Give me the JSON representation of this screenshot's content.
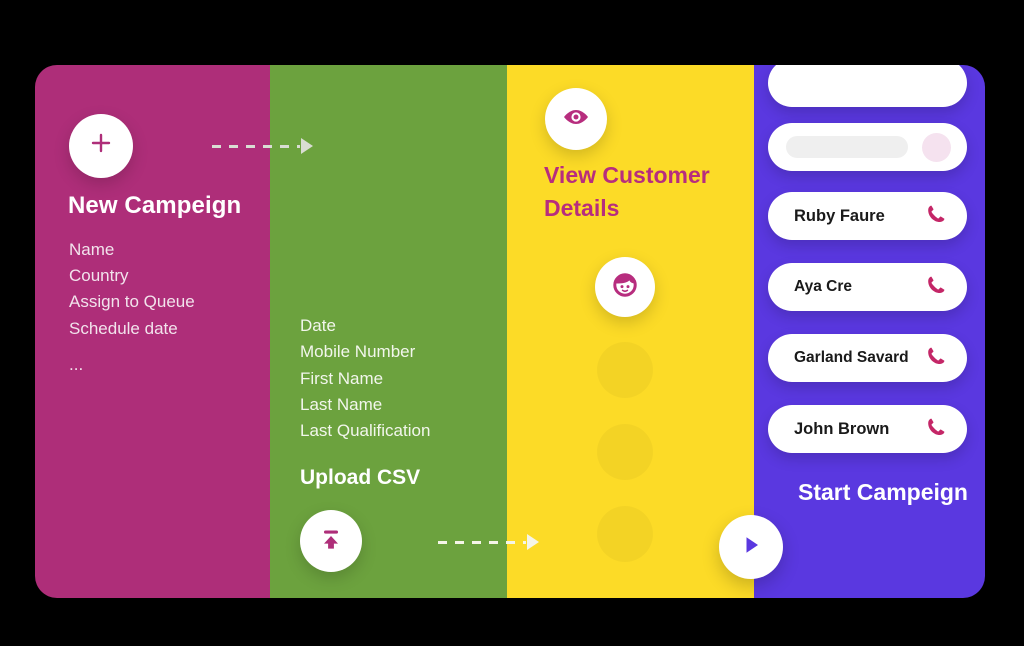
{
  "colors": {
    "magenta": "#AE2E79",
    "green": "#6CA23E",
    "yellow": "#FCDB27",
    "purple": "#5A38E0",
    "accent_pink": "#B72D7E",
    "phone_icon": "#C42667",
    "background": "#000000"
  },
  "campaign_panel": {
    "add_icon": "plus-icon",
    "title": "New Campeign",
    "fields": [
      "Name",
      "Country",
      "Assign to Queue",
      "Schedule date"
    ],
    "more": "..."
  },
  "csv_panel": {
    "fields": [
      "Date",
      "Mobile Number",
      "First Name",
      "Last Name",
      "Last Qualification"
    ],
    "title": "Upload CSV",
    "upload_icon": "upload-icon"
  },
  "customer_panel": {
    "eye_icon": "eye-icon",
    "title": "View Customer Details",
    "avatar_icon": "person-icon",
    "placeholder_dots": 3
  },
  "contacts_panel": {
    "cards": [
      {
        "type": "blank",
        "name": ""
      },
      {
        "type": "skeleton",
        "name": ""
      },
      {
        "type": "contact",
        "name": "Ruby Faure",
        "action_icon": "phone-icon"
      },
      {
        "type": "contact",
        "name": "Aya Cre",
        "action_icon": "phone-icon"
      },
      {
        "type": "contact",
        "name": "Garland Savard",
        "action_icon": "phone-icon"
      },
      {
        "type": "contact",
        "name": "John Brown",
        "action_icon": "phone-icon"
      }
    ],
    "start_title": "Start Campeign",
    "play_icon": "play-icon"
  },
  "connectors": [
    {
      "name": "campaign-to-csv",
      "icon": "dashed-arrow-right"
    },
    {
      "name": "csv-to-customer",
      "icon": "dashed-arrow-right"
    }
  ]
}
